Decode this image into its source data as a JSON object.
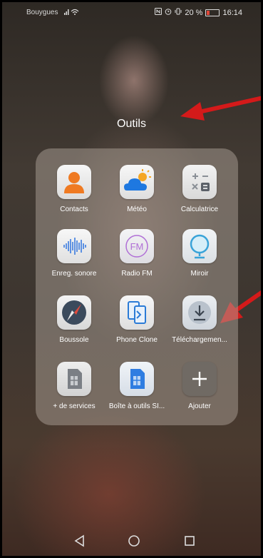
{
  "status_bar": {
    "carrier": "Bouygues",
    "battery": "20 %",
    "time": "16:14"
  },
  "folder": {
    "title": "Outils",
    "apps": [
      {
        "label": "Contacts",
        "icon": "contacts-icon"
      },
      {
        "label": "Météo",
        "icon": "weather-icon"
      },
      {
        "label": "Calculatrice",
        "icon": "calculator-icon"
      },
      {
        "label": "Enreg. sonore",
        "icon": "sound-recorder-icon"
      },
      {
        "label": "Radio FM",
        "icon": "radio-fm-icon",
        "icon_text": "FM"
      },
      {
        "label": "Miroir",
        "icon": "mirror-icon"
      },
      {
        "label": "Boussole",
        "icon": "compass-icon"
      },
      {
        "label": "Phone Clone",
        "icon": "phone-clone-icon"
      },
      {
        "label": "Téléchargemen...",
        "icon": "download-icon"
      },
      {
        "label": "+ de services",
        "icon": "sim-services-icon"
      },
      {
        "label": "Boîte à outils SI...",
        "icon": "sim-toolkit-icon"
      },
      {
        "label": "Ajouter",
        "icon": "add-icon"
      }
    ]
  },
  "annotations": [
    {
      "name": "red-arrow-to-folder-title",
      "color": "#d41a1a"
    },
    {
      "name": "red-arrow-to-downloads",
      "color": "#d41a1a"
    }
  ],
  "nav_bar": {
    "buttons": [
      "back-icon",
      "home-icon",
      "recents-icon"
    ]
  }
}
